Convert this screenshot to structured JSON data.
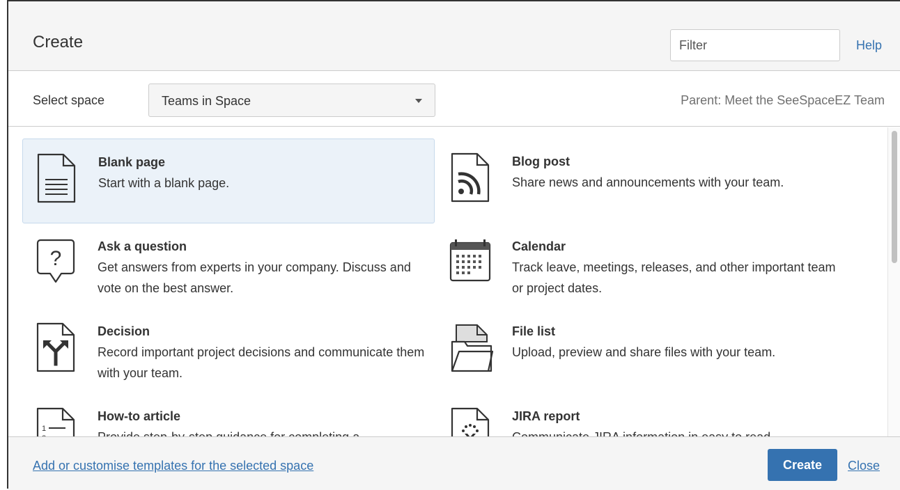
{
  "header": {
    "title": "Create",
    "filter_placeholder": "Filter",
    "help_label": "Help"
  },
  "space": {
    "label": "Select space",
    "selected": "Teams in Space",
    "parent": "Parent: Meet the SeeSpaceEZ Team"
  },
  "templates": [
    {
      "name": "Blank page",
      "description": "Start with a blank page.",
      "icon": "blank-page-icon",
      "selected": true
    },
    {
      "name": "Blog post",
      "description": "Share news and announcements with your team.",
      "icon": "blog-post-icon",
      "selected": false
    },
    {
      "name": "Ask a question",
      "description": "Get answers from experts in your company. Discuss and vote on the best answer.",
      "icon": "question-icon",
      "selected": false
    },
    {
      "name": "Calendar",
      "description": "Track leave, meetings, releases, and other important team or project dates.",
      "icon": "calendar-icon",
      "selected": false
    },
    {
      "name": "Decision",
      "description": "Record important project decisions and communicate them with your team.",
      "icon": "decision-icon",
      "selected": false
    },
    {
      "name": "File list",
      "description": "Upload, preview and share files with your team.",
      "icon": "folder-icon",
      "selected": false
    },
    {
      "name": "How-to article",
      "description": "Provide step-by-step guidance for completing a",
      "icon": "how-to-icon",
      "selected": false
    },
    {
      "name": "JIRA report",
      "description": "Communicate JIRA information in easy to read",
      "icon": "jira-report-icon",
      "selected": false
    }
  ],
  "footer": {
    "templates_link": "Add or customise templates for the selected space",
    "create_label": "Create",
    "close_label": "Close"
  },
  "colors": {
    "accent": "#3572b0",
    "selected_bg": "#ebf2f9",
    "header_bg": "#f5f5f5"
  }
}
